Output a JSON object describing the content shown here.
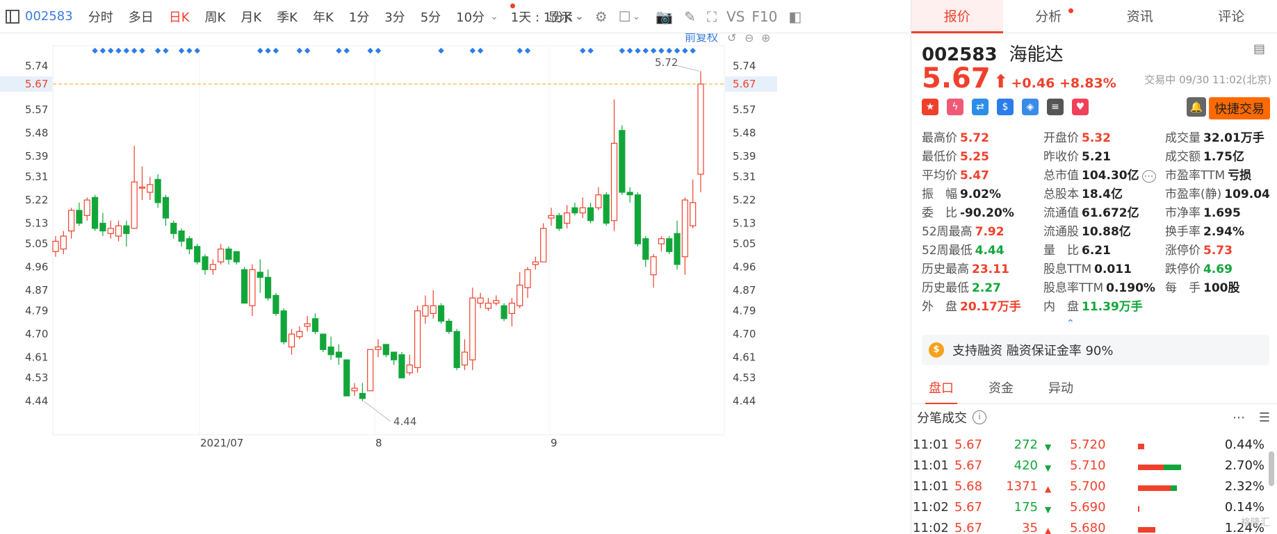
{
  "toolbar": {
    "stock_code": "002583",
    "periods": [
      "分时",
      "多日",
      "日K",
      "周K",
      "月K",
      "季K",
      "年K",
      "1分",
      "3分",
      "5分",
      "10分"
    ],
    "active_period": "日K",
    "interval_select": "1天 : 1分K",
    "display_label": "显示",
    "vs_label": "VS",
    "f10_label": "F10",
    "adjust_label": "前复权"
  },
  "chart_data": {
    "type": "candlestick",
    "y_ticks": [
      "5.74",
      "5.67",
      "5.57",
      "5.48",
      "5.39",
      "5.31",
      "5.22",
      "5.13",
      "5.05",
      "4.96",
      "4.87",
      "4.79",
      "4.70",
      "4.61",
      "4.53",
      "4.44"
    ],
    "ylim": [
      4.37,
      5.8
    ],
    "current_price_label": "5.67",
    "x_labels": [
      "2021/07",
      "8",
      "9"
    ],
    "high_annotation": "5.72",
    "low_annotation": "4.44",
    "candles": [
      {
        "o": 5.02,
        "c": 5.06,
        "h": 5.08,
        "l": 5.0
      },
      {
        "o": 5.03,
        "c": 5.08,
        "h": 5.1,
        "l": 5.01
      },
      {
        "o": 5.1,
        "c": 5.18,
        "h": 5.19,
        "l": 5.07
      },
      {
        "o": 5.18,
        "c": 5.13,
        "h": 5.21,
        "l": 5.12
      },
      {
        "o": 5.16,
        "c": 5.22,
        "h": 5.23,
        "l": 5.14
      },
      {
        "o": 5.23,
        "c": 5.11,
        "h": 5.24,
        "l": 5.1
      },
      {
        "o": 5.13,
        "c": 5.1,
        "h": 5.17,
        "l": 5.08
      },
      {
        "o": 5.09,
        "c": 5.11,
        "h": 5.14,
        "l": 5.07
      },
      {
        "o": 5.08,
        "c": 5.12,
        "h": 5.14,
        "l": 5.06
      },
      {
        "o": 5.12,
        "c": 5.09,
        "h": 5.14,
        "l": 5.04
      },
      {
        "o": 5.11,
        "c": 5.29,
        "h": 5.43,
        "l": 5.11
      },
      {
        "o": 5.27,
        "c": 5.27,
        "h": 5.35,
        "l": 5.22
      },
      {
        "o": 5.25,
        "c": 5.28,
        "h": 5.31,
        "l": 5.22
      },
      {
        "o": 5.3,
        "c": 5.21,
        "h": 5.32,
        "l": 5.19
      },
      {
        "o": 5.23,
        "c": 5.15,
        "h": 5.24,
        "l": 5.12
      },
      {
        "o": 5.13,
        "c": 5.09,
        "h": 5.14,
        "l": 5.07
      },
      {
        "o": 5.1,
        "c": 5.06,
        "h": 5.11,
        "l": 5.04
      },
      {
        "o": 5.07,
        "c": 5.03,
        "h": 5.08,
        "l": 5.01
      },
      {
        "o": 5.04,
        "c": 4.98,
        "h": 5.05,
        "l": 4.97
      },
      {
        "o": 5.0,
        "c": 4.95,
        "h": 5.01,
        "l": 4.93
      },
      {
        "o": 4.95,
        "c": 4.97,
        "h": 4.99,
        "l": 4.93
      },
      {
        "o": 4.98,
        "c": 5.03,
        "h": 5.05,
        "l": 4.97
      },
      {
        "o": 5.03,
        "c": 4.99,
        "h": 5.04,
        "l": 4.97
      },
      {
        "o": 5.02,
        "c": 4.98,
        "h": 5.02,
        "l": 4.97
      },
      {
        "o": 4.95,
        "c": 4.82,
        "h": 4.96,
        "l": 4.82
      },
      {
        "o": 4.81,
        "c": 4.95,
        "h": 4.97,
        "l": 4.77
      },
      {
        "o": 4.94,
        "c": 4.92,
        "h": 4.99,
        "l": 4.86
      },
      {
        "o": 4.92,
        "c": 4.84,
        "h": 4.95,
        "l": 4.83
      },
      {
        "o": 4.85,
        "c": 4.78,
        "h": 4.86,
        "l": 4.77
      },
      {
        "o": 4.79,
        "c": 4.67,
        "h": 4.8,
        "l": 4.66
      },
      {
        "o": 4.65,
        "c": 4.7,
        "h": 4.72,
        "l": 4.62
      },
      {
        "o": 4.69,
        "c": 4.71,
        "h": 4.73,
        "l": 4.68
      },
      {
        "o": 4.73,
        "c": 4.74,
        "h": 4.77,
        "l": 4.71
      },
      {
        "o": 4.76,
        "c": 4.71,
        "h": 4.78,
        "l": 4.7
      },
      {
        "o": 4.7,
        "c": 4.64,
        "h": 4.7,
        "l": 4.63
      },
      {
        "o": 4.65,
        "c": 4.62,
        "h": 4.69,
        "l": 4.6
      },
      {
        "o": 4.63,
        "c": 4.61,
        "h": 4.66,
        "l": 4.58
      },
      {
        "o": 4.6,
        "c": 4.46,
        "h": 4.6,
        "l": 4.46
      },
      {
        "o": 4.48,
        "c": 4.49,
        "h": 4.51,
        "l": 4.46
      },
      {
        "o": 4.47,
        "c": 4.45,
        "h": 4.51,
        "l": 4.44
      },
      {
        "o": 4.48,
        "c": 4.64,
        "h": 4.64,
        "l": 4.48
      },
      {
        "o": 4.64,
        "c": 4.65,
        "h": 4.68,
        "l": 4.61
      },
      {
        "o": 4.66,
        "c": 4.62,
        "h": 4.66,
        "l": 4.61
      },
      {
        "o": 4.63,
        "c": 4.6,
        "h": 4.63,
        "l": 4.58
      },
      {
        "o": 4.62,
        "c": 4.53,
        "h": 4.63,
        "l": 4.53
      },
      {
        "o": 4.55,
        "c": 4.58,
        "h": 4.62,
        "l": 4.54
      },
      {
        "o": 4.57,
        "c": 4.79,
        "h": 4.81,
        "l": 4.55
      },
      {
        "o": 4.77,
        "c": 4.81,
        "h": 4.85,
        "l": 4.74
      },
      {
        "o": 4.78,
        "c": 4.81,
        "h": 4.87,
        "l": 4.76
      },
      {
        "o": 4.81,
        "c": 4.75,
        "h": 4.82,
        "l": 4.74
      },
      {
        "o": 4.75,
        "c": 4.71,
        "h": 4.76,
        "l": 4.7
      },
      {
        "o": 4.71,
        "c": 4.57,
        "h": 4.72,
        "l": 4.56
      },
      {
        "o": 4.58,
        "c": 4.63,
        "h": 4.68,
        "l": 4.56
      },
      {
        "o": 4.6,
        "c": 4.84,
        "h": 4.88,
        "l": 4.56
      },
      {
        "o": 4.82,
        "c": 4.84,
        "h": 4.86,
        "l": 4.8
      },
      {
        "o": 4.8,
        "c": 4.82,
        "h": 4.84,
        "l": 4.79
      },
      {
        "o": 4.82,
        "c": 4.83,
        "h": 4.85,
        "l": 4.81
      },
      {
        "o": 4.81,
        "c": 4.76,
        "h": 4.82,
        "l": 4.75
      },
      {
        "o": 4.78,
        "c": 4.82,
        "h": 4.84,
        "l": 4.73
      },
      {
        "o": 4.81,
        "c": 4.89,
        "h": 4.94,
        "l": 4.8
      },
      {
        "o": 4.88,
        "c": 4.95,
        "h": 4.96,
        "l": 4.84
      },
      {
        "o": 4.97,
        "c": 4.98,
        "h": 5.0,
        "l": 4.95
      },
      {
        "o": 4.98,
        "c": 5.11,
        "h": 5.13,
        "l": 4.98
      },
      {
        "o": 5.15,
        "c": 5.16,
        "h": 5.19,
        "l": 5.12
      },
      {
        "o": 5.16,
        "c": 5.11,
        "h": 5.17,
        "l": 5.1
      },
      {
        "o": 5.13,
        "c": 5.17,
        "h": 5.2,
        "l": 5.11
      },
      {
        "o": 5.19,
        "c": 5.17,
        "h": 5.21,
        "l": 5.16
      },
      {
        "o": 5.17,
        "c": 5.19,
        "h": 5.23,
        "l": 5.15
      },
      {
        "o": 5.19,
        "c": 5.14,
        "h": 5.21,
        "l": 5.13
      },
      {
        "o": 5.19,
        "c": 5.24,
        "h": 5.27,
        "l": 5.18
      },
      {
        "o": 5.24,
        "c": 5.13,
        "h": 5.25,
        "l": 5.12
      },
      {
        "o": 5.14,
        "c": 5.44,
        "h": 5.61,
        "l": 5.1
      },
      {
        "o": 5.49,
        "c": 5.25,
        "h": 5.51,
        "l": 5.24
      },
      {
        "o": 5.25,
        "c": 5.24,
        "h": 5.27,
        "l": 5.21
      },
      {
        "o": 5.24,
        "c": 5.05,
        "h": 5.25,
        "l": 5.04
      },
      {
        "o": 5.07,
        "c": 4.99,
        "h": 5.08,
        "l": 4.96
      },
      {
        "o": 4.93,
        "c": 5.0,
        "h": 5.01,
        "l": 4.88
      },
      {
        "o": 5.05,
        "c": 5.07,
        "h": 5.08,
        "l": 5.02
      },
      {
        "o": 5.07,
        "c": 5.02,
        "h": 5.08,
        "l": 5.01
      },
      {
        "o": 5.09,
        "c": 4.97,
        "h": 5.14,
        "l": 4.95
      },
      {
        "o": 5.0,
        "c": 5.22,
        "h": 5.23,
        "l": 4.93
      },
      {
        "o": 5.12,
        "c": 5.21,
        "h": 5.3,
        "l": 5.11
      },
      {
        "o": 5.32,
        "c": 5.67,
        "h": 5.72,
        "l": 5.25
      }
    ]
  },
  "panel": {
    "tabs": [
      "报价",
      "分析",
      "资讯",
      "评论"
    ],
    "active_tab": "报价",
    "stock_code": "002583",
    "stock_name": "海能达",
    "price": "5.67",
    "change": "+0.46",
    "change_pct": "+8.83%",
    "trade_status": "交易中 09/30 11:02(北京)",
    "quick_trade": "快捷交易",
    "stats": [
      [
        {
          "l": "最高价",
          "v": "5.72",
          "c": "up"
        },
        {
          "l": "开盘价",
          "v": "5.32",
          "c": "up"
        },
        {
          "l": "成交量",
          "v": "32.01万手",
          "c": "neu"
        }
      ],
      [
        {
          "l": "最低价",
          "v": "5.25",
          "c": "up"
        },
        {
          "l": "昨收价",
          "v": "5.21",
          "c": "neu"
        },
        {
          "l": "成交额",
          "v": "1.75亿",
          "c": "neu"
        }
      ],
      [
        {
          "l": "平均价",
          "v": "5.47",
          "c": "up"
        },
        {
          "l": "总市值",
          "v": "104.30亿",
          "c": "neu"
        },
        {
          "l": "市盈率TTM",
          "v": "亏损",
          "c": "neu"
        }
      ],
      [
        {
          "l": "振　幅",
          "v": "9.02%",
          "c": "neu"
        },
        {
          "l": "总股本",
          "v": "18.4亿",
          "c": "neu"
        },
        {
          "l": "市盈率(静)",
          "v": "109.04",
          "c": "neu"
        }
      ],
      [
        {
          "l": "委　比",
          "v": "-90.20%",
          "c": "neu"
        },
        {
          "l": "流通值",
          "v": "61.672亿",
          "c": "neu"
        },
        {
          "l": "市净率",
          "v": "1.695",
          "c": "neu"
        }
      ],
      [
        {
          "l": "52周最高",
          "v": "7.92",
          "c": "up"
        },
        {
          "l": "流通股",
          "v": "10.88亿",
          "c": "neu"
        },
        {
          "l": "换手率",
          "v": "2.94%",
          "c": "neu"
        }
      ],
      [
        {
          "l": "52周最低",
          "v": "4.44",
          "c": "down"
        },
        {
          "l": "量　比",
          "v": "6.21",
          "c": "neu"
        },
        {
          "l": "涨停价",
          "v": "5.73",
          "c": "up"
        }
      ],
      [
        {
          "l": "历史最高",
          "v": "23.11",
          "c": "up"
        },
        {
          "l": "股息TTM",
          "v": "0.011",
          "c": "neu"
        },
        {
          "l": "跌停价",
          "v": "4.69",
          "c": "down"
        }
      ],
      [
        {
          "l": "历史最低",
          "v": "2.27",
          "c": "down"
        },
        {
          "l": "股息率TTM",
          "v": "0.190%",
          "c": "neu"
        },
        {
          "l": "每　手",
          "v": "100股",
          "c": "neu"
        }
      ],
      [
        {
          "l": "外　盘",
          "v": "20.17万手",
          "c": "up"
        },
        {
          "l": "内　盘",
          "v": "11.39万手",
          "c": "down"
        },
        {
          "l": "",
          "v": "",
          "c": "neu"
        }
      ]
    ],
    "margin_text": "支持融资 融资保证金率 90%",
    "subtabs": [
      "盘口",
      "资金",
      "异动"
    ],
    "active_subtab": "盘口",
    "ticks_title": "分笔成交",
    "ticks": [
      {
        "time": "11:01",
        "price": "5.67",
        "vol": "272",
        "dir": "down",
        "p2": "5.720",
        "pct": "0.44%",
        "bar_red": 0.15,
        "bar_green": 0.0
      },
      {
        "time": "11:01",
        "price": "5.67",
        "vol": "420",
        "dir": "down",
        "p2": "5.710",
        "pct": "2.70%",
        "bar_red": 0.6,
        "bar_green": 0.4
      },
      {
        "time": "11:01",
        "price": "5.68",
        "vol": "1371",
        "dir": "up",
        "p2": "5.700",
        "pct": "2.32%",
        "bar_red": 0.75,
        "bar_green": 0.15
      },
      {
        "time": "11:02",
        "price": "5.67",
        "vol": "175",
        "dir": "down",
        "p2": "5.690",
        "pct": "0.14%",
        "bar_red": 0.04,
        "bar_green": 0.0
      },
      {
        "time": "11:02",
        "price": "5.67",
        "vol": "35",
        "dir": "up",
        "p2": "5.680",
        "pct": "1.24%",
        "bar_red": 0.4,
        "bar_green": 0.0
      }
    ],
    "watermark": "格隆汇"
  },
  "colors": {
    "up": "#f0402c",
    "down": "#12a63a",
    "accent": "#3a7be0"
  }
}
